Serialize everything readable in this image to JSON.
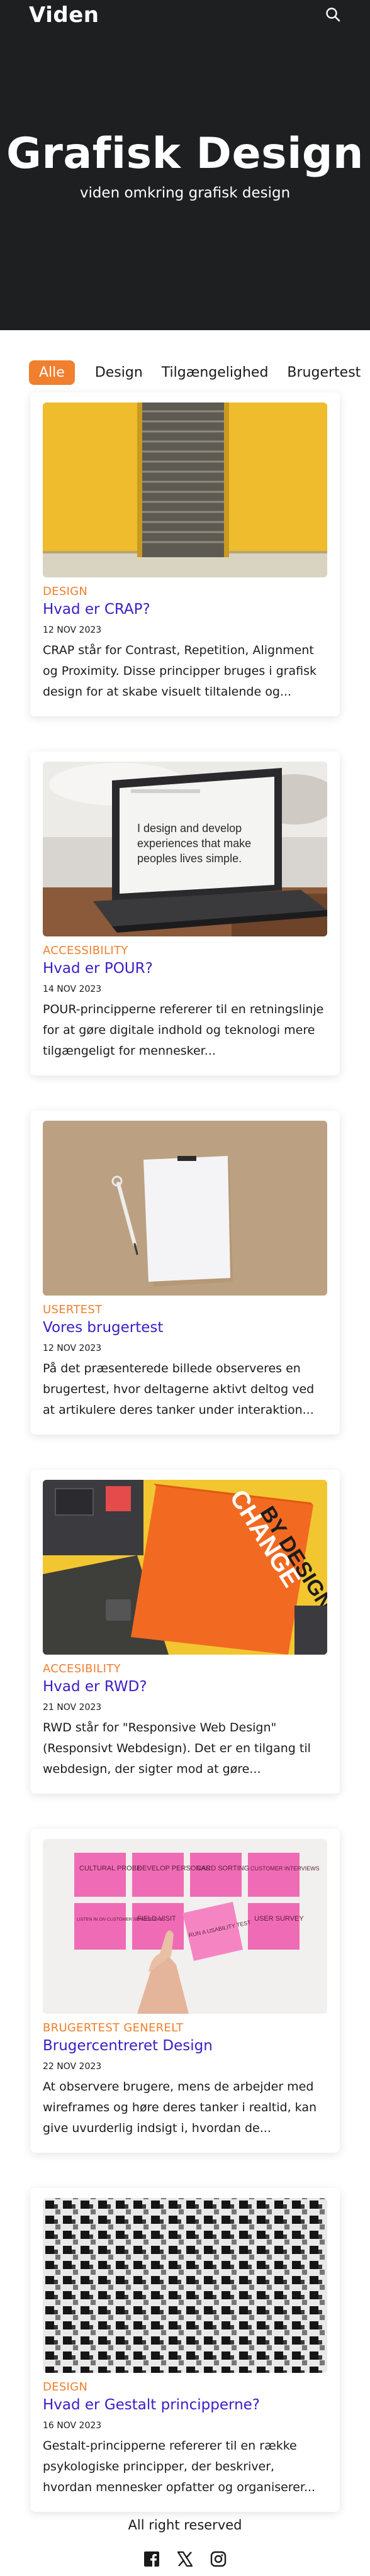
{
  "header": {
    "logo": "Viden"
  },
  "hero": {
    "title": "Grafisk Design",
    "subtitle": "viden omkring grafisk design"
  },
  "filters": [
    "Alle",
    "Design",
    "Tilgængelighed",
    "Brugertest"
  ],
  "posts": [
    {
      "category": "Design",
      "title": "Hvad er CRAP?",
      "date": "12 NOV 2023",
      "excerpt": "CRAP står for Contrast, Repetition, Alignment og Proximity. Disse principper bruges i grafisk design for at skabe visuelt tiltalende og...",
      "image": "yellow-wall-shutter"
    },
    {
      "category": "Accessibility",
      "title": "Hvad er POUR?",
      "date": "14 NOV 2023",
      "excerpt": "POUR-principperne refererer til en retningslinje for at gøre digitale indhold og teknologi mere tilgængeligt for mennesker...",
      "image": "laptop-on-desk",
      "image_text": [
        "I design and develop",
        "experiences that make",
        "peoples lives simple."
      ]
    },
    {
      "category": "Usertest",
      "title": "Vores brugertest",
      "date": "12 NOV 2023",
      "excerpt": "På det præsenterede billede observeres en brugertest, hvor deltagerne aktivt deltog ved at artikulere deres tanker under interaktion...",
      "image": "paper-and-pen"
    },
    {
      "category": "Accesibility",
      "title": "Hvad er RWD?",
      "date": "21 NOV 2023",
      "excerpt": "RWD står for \"Responsive Web Design\" (Responsivt Webdesign). Det er en tilgang til webdesign, der sigter mod at gøre...",
      "image": "change-by-design-book",
      "image_text": [
        "CHANGE",
        "BY DESIGN"
      ]
    },
    {
      "category": "Brugertest Generelt",
      "title": "Brugercentreret Design",
      "date": "22 NOV 2023",
      "excerpt": "At observere brugere, mens de arbejder med wireframes og høre deres tanker i realtid, kan give uvurderlig indsigt i, hvordan de...",
      "image": "sticky-notes",
      "image_text": [
        "CULTURAL PROBE",
        "DEVELOP PERSONAS",
        "CARD SORTING",
        "CUSTOMER INTERVIEWS",
        "LISTEN IN ON CUSTOMER SERVICE CALL",
        "FIELD VISIT",
        "RUN A USABILITY TEST",
        "USER SURVEY"
      ]
    },
    {
      "category": "Design",
      "title": "Hvad er Gestalt principperne?",
      "date": "16 NOV 2023",
      "excerpt": "Gestalt-principperne refererer til en række psykologiske principper, der beskriver, hvordan mennesker opfatter og organiserer...",
      "image": "building-windows-pattern"
    }
  ],
  "footer": {
    "text": "All right reserved",
    "social": [
      "facebook-icon",
      "x-icon",
      "instagram-icon"
    ]
  },
  "colors": {
    "accent": "#f07f2e",
    "link": "#3b1dc6",
    "hero_bg": "#1e1f21"
  }
}
